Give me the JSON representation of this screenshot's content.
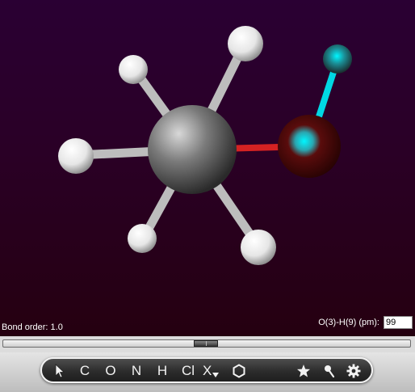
{
  "viewer": {
    "bond_order": "Bond order: 1.0",
    "measure_label": "O(3)-H(9) (pm):",
    "measure_value": "99"
  },
  "toolbar": {
    "select_icon": "cursor-arrow-icon",
    "carbon": "C",
    "oxygen": "O",
    "nitrogen": "N",
    "hydrogen": "H",
    "chlorine": "Cl",
    "halogen": "X",
    "ring_icon": "hexagon-icon",
    "favorite_icon": "star-icon",
    "measure_icon": "pin-icon",
    "settings_icon": "gear-icon"
  },
  "colors": {
    "background_top": "#2a0033",
    "background_bottom": "#250010",
    "carbon": "#8a8a8a",
    "hydrogen": "#ffffff",
    "oxygen": "#5a0808",
    "selected_highlight": "#00e5ef",
    "bond_cc": "#bdbdbd",
    "bond_co": "#d42222"
  }
}
